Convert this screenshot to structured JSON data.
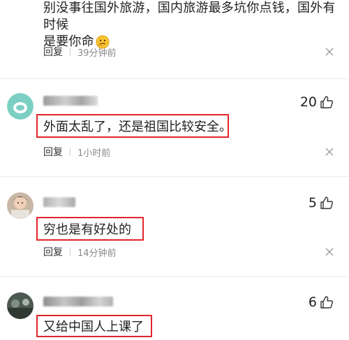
{
  "top_comment": {
    "text_line1": "别没事往国外旅游，国内旅游最多坑你点钱，国外有时候",
    "text_line2": "是要你命",
    "reply_label": "回复",
    "time": "39分钟前"
  },
  "comments": [
    {
      "likes": "20",
      "text": "外面太乱了，还是祖国比较安全。",
      "reply_label": "回复",
      "time": "1小时前"
    },
    {
      "likes": "5",
      "text": "穷也是有好处的",
      "reply_label": "回复",
      "time": "14分钟前"
    },
    {
      "likes": "6",
      "text": "又给中国人上课了"
    }
  ],
  "colors": {
    "highlight_border": "#e3242b",
    "meta_text": "#8a8a8a",
    "divider": "#ececec"
  }
}
